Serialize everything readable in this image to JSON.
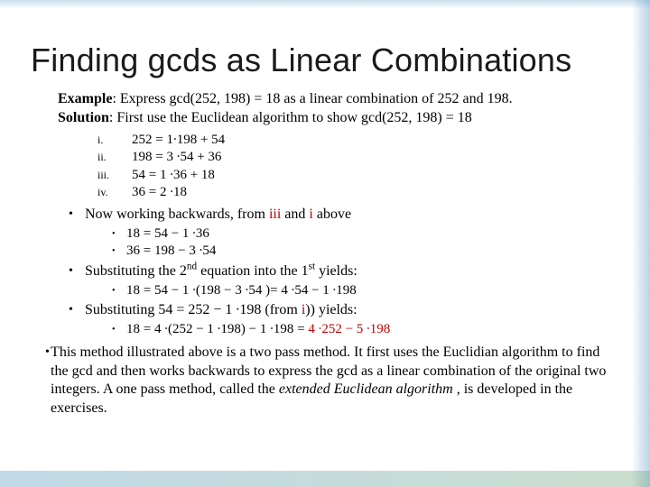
{
  "title": "Finding gcds as Linear Combinations",
  "example_label": "Example",
  "example_text": ": Express gcd(252, 198) = 18 as a linear combination of 252 and 198.",
  "solution_label": "Solution",
  "solution_text": ": First use the Euclidean algorithm to show gcd(252, 198) = 18",
  "roman": {
    "i_m": "i.",
    "i": "252 = 1∙198 + 54",
    "ii_m": "ii.",
    "ii": "198 = 3 ∙54 + 36",
    "iii_m": "iii.",
    "iii": "54 = 1 ∙36 + 18",
    "iv_m": "iv.",
    "iv": "36 = 2 ∙18"
  },
  "b1_pre": "Now working backwards, from ",
  "b1_iii": "iii",
  "b1_mid": " and ",
  "b1_i": "i",
  "b1_post": " above",
  "sub1a": "18 = 54 − 1 ∙36",
  "sub1b": "36 = 198 − 3 ∙54",
  "b2_pre": "Substituting the 2",
  "b2_nd": "nd",
  "b2_mid": " equation into the 1",
  "b2_st": "st",
  "b2_post": " yields:",
  "sub2": "18 = 54 − 1 ∙(198 − 3 ∙54 )= 4 ∙54 − 1 ∙198",
  "b3_pre": "Substituting 54 = 252 − 1 ∙198 (from ",
  "b3_i": "i",
  "b3_post": ")) yields:",
  "sub3_pre": "18 = 4 ∙(252 − 1 ∙198) − 1 ∙198 = ",
  "sub3_red": "4 ∙252 − 5 ∙198",
  "final_pre": "This method illustrated above is a two pass method. It first uses the Euclidian algorithm to find the gcd and then works backwards to express the gcd as a linear combination of the original two integers. A one pass method, called the ",
  "final_ital": "extended Euclidean algorithm",
  "final_post": " , is developed in the exercises.",
  "bullet": "•"
}
